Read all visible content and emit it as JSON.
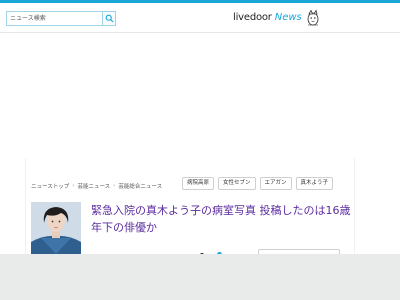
{
  "header": {
    "search_placeholder": "ニュース検索",
    "logo_main": "livedoor",
    "logo_news": "News"
  },
  "breadcrumb": [
    "ニューストップ",
    "芸能ニュース",
    "芸能総合ニュース"
  ],
  "tags": [
    "病院高原",
    "女性セブン",
    "エアガン",
    "真木よう子"
  ],
  "article": {
    "title": "緊急入院の真木よう子の病室写真 投稿したのは16歳年下の俳優か"
  },
  "colors": {
    "accent": "#1aa6d6",
    "title": "#5b2ca0",
    "footer": "#e9eaea"
  }
}
